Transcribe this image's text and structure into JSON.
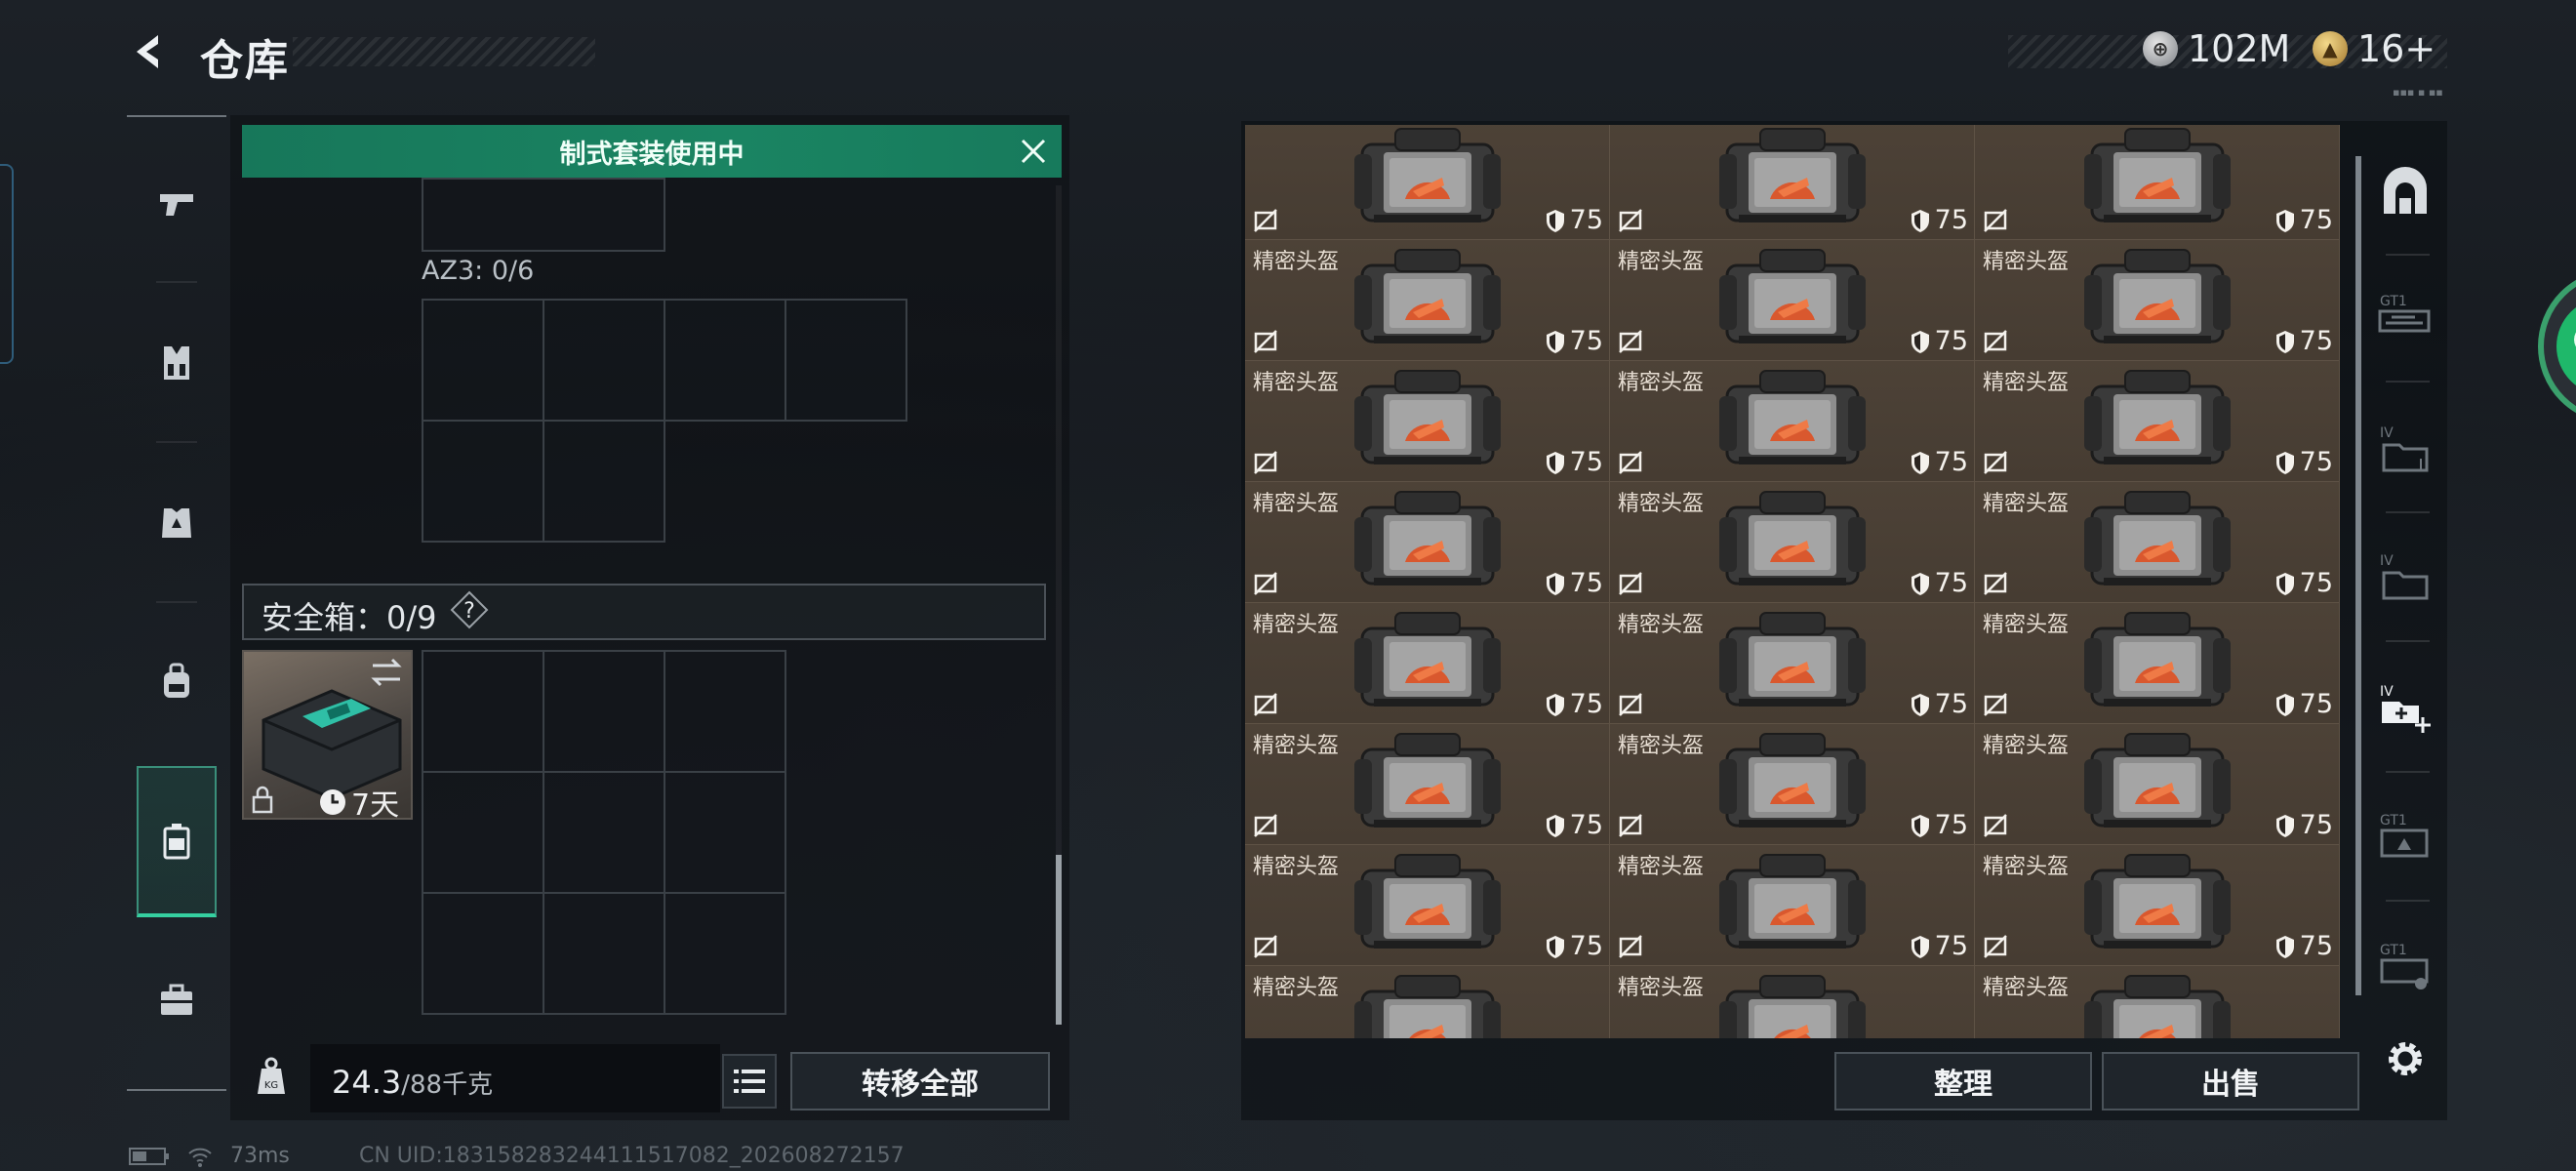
{
  "header": {
    "title": "仓库",
    "currency_silver": "102M",
    "currency_gold": "16+"
  },
  "banner": {
    "text": "制式套装使用中"
  },
  "container": {
    "az3_label": "AZ3: 0/6"
  },
  "safebox": {
    "label": "安全箱：0/9",
    "help": "?",
    "timer": "7天"
  },
  "footer_left": {
    "weight": "24.3",
    "weight_max": "/88千克",
    "transfer_all": "转移全部"
  },
  "footer_right": {
    "sort": "整理",
    "sell": "出售"
  },
  "item_tile": {
    "name": "精密头盔",
    "armor": "75"
  },
  "status_bar": {
    "ping": "73ms",
    "uid": "CN UID:18315828324411151708​2_202608272157"
  },
  "colors": {
    "accent_green": "#1a8462",
    "tile_brown": "#4a3f35"
  }
}
